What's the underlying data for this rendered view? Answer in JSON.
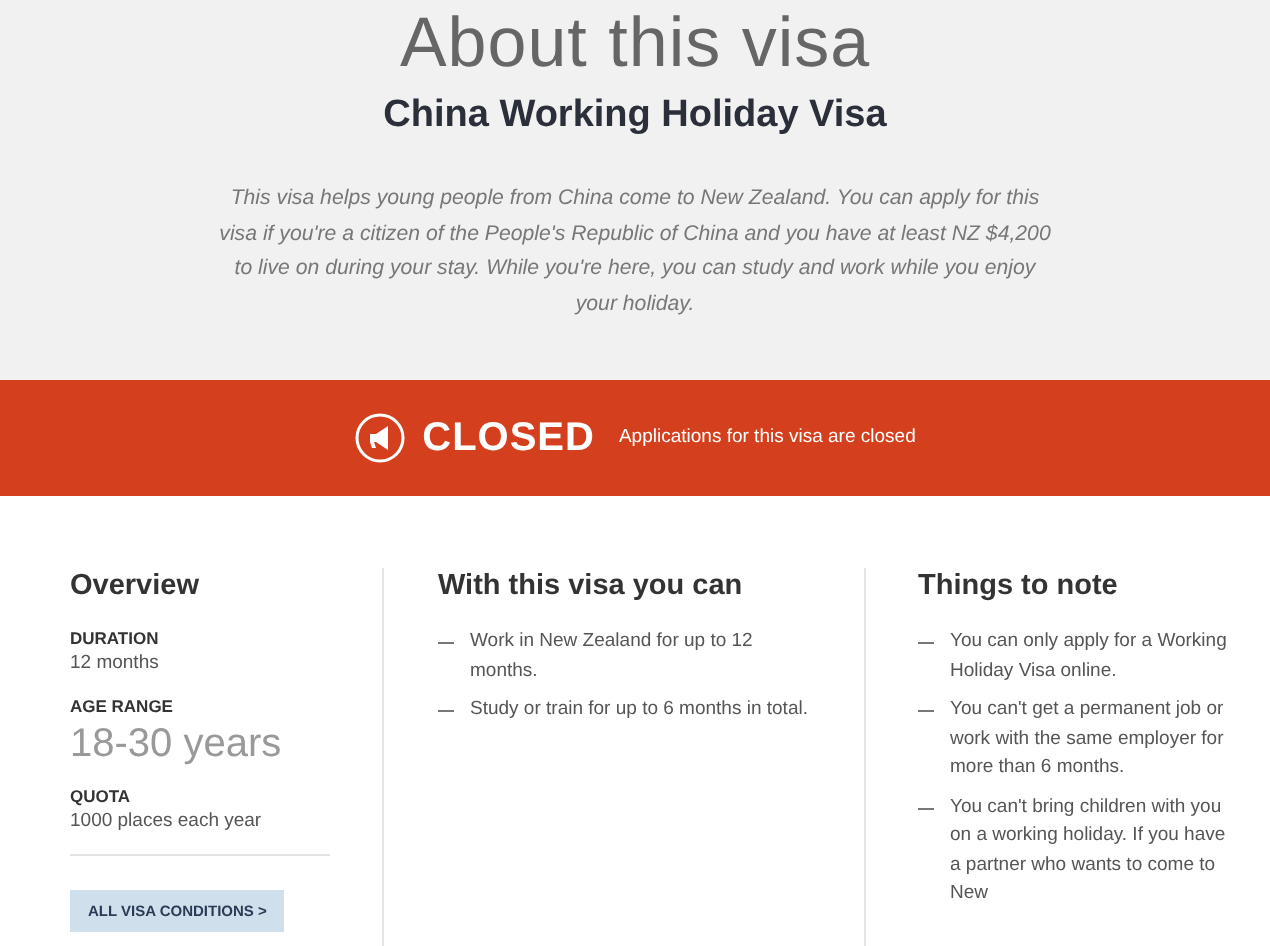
{
  "header": {
    "title": "About this visa",
    "subtitle": "China Working Holiday Visa",
    "intro": "This visa helps young people from China come to New Zealand. You can apply for this visa if you're a citizen of the People's Republic of China and you have at least NZ $4,200 to live on during your stay. While you're here, you can study and work while you enjoy your holiday."
  },
  "status_banner": {
    "status": "CLOSED",
    "message": "Applications for this visa are closed"
  },
  "overview": {
    "heading": "Overview",
    "facts": [
      {
        "kind": "plain",
        "label": "DURATION",
        "value": "12 months"
      },
      {
        "kind": "large",
        "label": "AGE RANGE",
        "value": "18-30 years"
      },
      {
        "kind": "plain",
        "label": "QUOTA",
        "value": "1000 places each year"
      }
    ],
    "button": "ALL VISA CONDITIONS >"
  },
  "can_do": {
    "heading": "With this visa you can",
    "items": [
      "Work in New Zealand for up to 12 months.",
      "Study or train for up to 6 months in total."
    ]
  },
  "notes": {
    "heading": "Things to note",
    "items": [
      "You can only apply for a Working Holiday Visa online.",
      "You can't get a permanent job or work with the same employer for more than 6 months.",
      "You can't bring children with you on a working holiday. If you have a partner who wants to come to New"
    ]
  }
}
